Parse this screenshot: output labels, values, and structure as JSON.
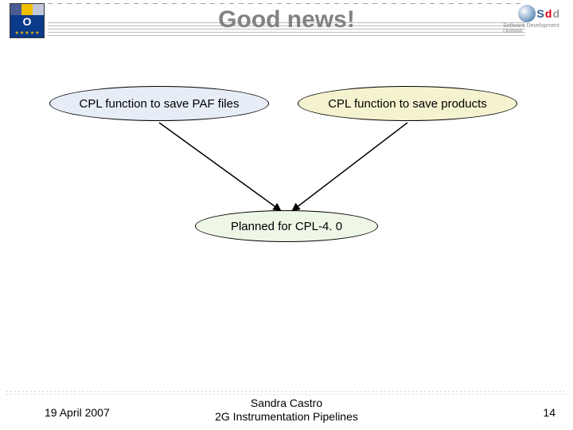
{
  "title": "Good news!",
  "logo_left": {
    "letter": "O",
    "alt": "ESO logo"
  },
  "logo_right": {
    "text_s": "S",
    "text_d1": "d",
    "text_d2": "d",
    "sub": "Software Development Division"
  },
  "nodes": {
    "left": "CPL function to save PAF files",
    "right": "CPL function to save products",
    "bottom": "Planned for CPL-4. 0"
  },
  "footer": {
    "date": "19 April 2007",
    "author": "Sandra Castro",
    "group": "2G Instrumentation Pipelines",
    "page": "14"
  }
}
